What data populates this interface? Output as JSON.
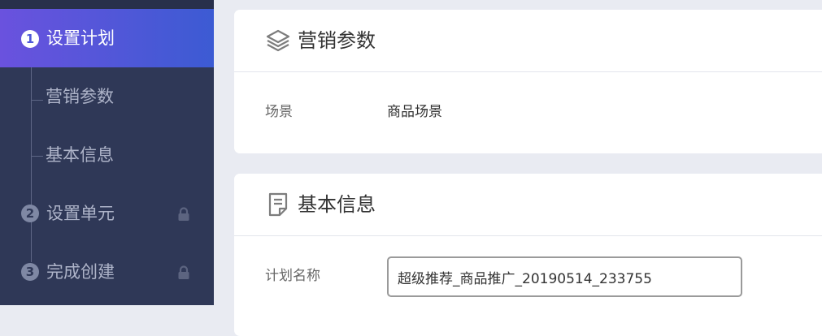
{
  "sidebar": {
    "steps": [
      {
        "number": "1",
        "label": "设置计划",
        "active": true
      },
      {
        "number": "2",
        "label": "设置单元",
        "locked": true
      },
      {
        "number": "3",
        "label": "完成创建",
        "locked": true
      }
    ],
    "sub_items": [
      {
        "label": "营销参数"
      },
      {
        "label": "基本信息"
      }
    ],
    "icons": {
      "lock": "lock-icon"
    }
  },
  "marketing_params": {
    "icon": "layers-icon",
    "title": "营销参数",
    "scene_label": "场景",
    "scene_value": "商品场景"
  },
  "basic_info": {
    "icon": "document-icon",
    "title": "基本信息",
    "plan_name_label": "计划名称",
    "plan_name_value": "超级推荐_商品推广_20190514_233755"
  },
  "colors": {
    "accent_gradient_start": "#6a52de",
    "accent_gradient_end": "#3c5bd3",
    "sidebar_bg": "#2f3857",
    "page_bg": "#e9ebf2"
  }
}
